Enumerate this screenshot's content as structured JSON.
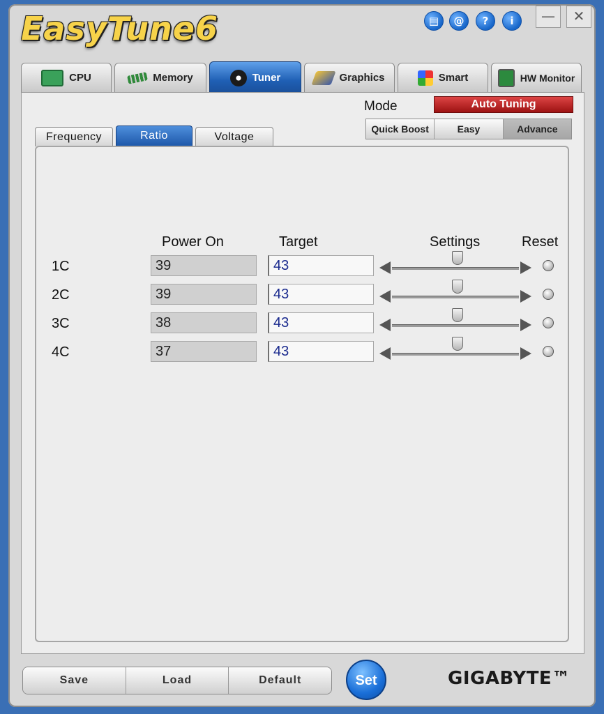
{
  "app": {
    "logo_text": "EasyTune6",
    "brand": "GIGABYTE™"
  },
  "header_icons": [
    {
      "name": "page-icon",
      "glyph": "▤"
    },
    {
      "name": "at-icon",
      "glyph": "@"
    },
    {
      "name": "help-icon",
      "glyph": "?"
    },
    {
      "name": "info-icon",
      "glyph": "i"
    }
  ],
  "window": {
    "minimize": "—",
    "close": "✕"
  },
  "main_tabs": [
    {
      "label": "CPU",
      "icon": "cpu-chip-icon",
      "active": false
    },
    {
      "label": "Memory",
      "icon": "memory-stick-icon",
      "active": false
    },
    {
      "label": "Tuner",
      "icon": "tuner-gauge-icon",
      "active": true
    },
    {
      "label": "Graphics",
      "icon": "graphics-card-icon",
      "active": false
    },
    {
      "label": "Smart",
      "icon": "cube-icon",
      "active": false
    },
    {
      "label": "HW Monitor",
      "icon": "monitor-icon",
      "active": false
    }
  ],
  "mode": {
    "label": "Mode",
    "auto_tuning": "Auto Tuning",
    "options": [
      "Quick Boost",
      "Easy",
      "Advance"
    ],
    "selected": "Advance"
  },
  "sub_tabs": [
    {
      "label": "Frequency",
      "active": false
    },
    {
      "label": "Ratio",
      "active": true
    },
    {
      "label": "Voltage",
      "active": false
    }
  ],
  "table": {
    "headers": {
      "power_on": "Power On",
      "target": "Target",
      "settings": "Settings",
      "reset": "Reset"
    },
    "rows": [
      {
        "label": "1C",
        "power_on": "39",
        "target": "43",
        "slider_fraction": 0.52
      },
      {
        "label": "2C",
        "power_on": "39",
        "target": "43",
        "slider_fraction": 0.52
      },
      {
        "label": "3C",
        "power_on": "38",
        "target": "43",
        "slider_fraction": 0.52
      },
      {
        "label": "4C",
        "power_on": "37",
        "target": "43",
        "slider_fraction": 0.52
      }
    ]
  },
  "bottom": {
    "save": "Save",
    "load": "Load",
    "default": "Default",
    "set": "Set"
  },
  "colors": {
    "accent": "#1f5fb4",
    "auto_tuning_bg": "#b31b1b",
    "target_text": "#1a2a8e"
  }
}
